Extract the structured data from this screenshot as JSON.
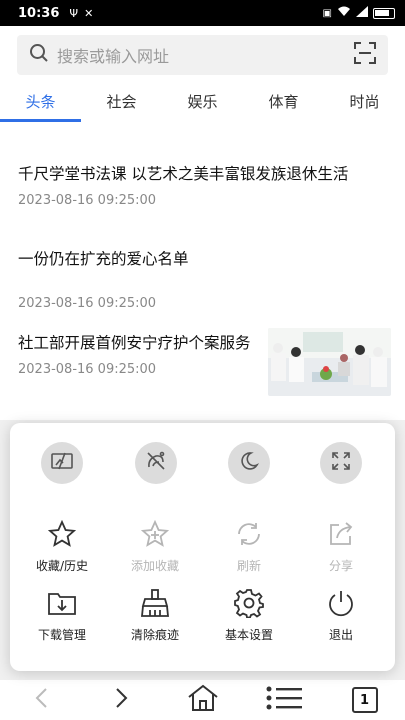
{
  "status_bar": {
    "time": "10:36",
    "battery": "100"
  },
  "search": {
    "placeholder": "搜索或输入网址"
  },
  "tabs": [
    {
      "label": "头条",
      "active": true
    },
    {
      "label": "社会"
    },
    {
      "label": "娱乐"
    },
    {
      "label": "体育"
    },
    {
      "label": "时尚"
    }
  ],
  "news": [
    {
      "title": "千尺学堂书法课 以艺术之美丰富银发族退休生活",
      "time": "2023-08-16 09:25:00"
    },
    {
      "title": "一份仍在扩充的爱心名单",
      "time": "2023-08-16 09:25:00"
    },
    {
      "title": "社工部开展首例安宁疗护个案服务",
      "time": "2023-08-16 09:25:00"
    }
  ],
  "menu": {
    "items": [
      {
        "label": "收藏/历史"
      },
      {
        "label": "添加收藏"
      },
      {
        "label": "刷新"
      },
      {
        "label": "分享"
      },
      {
        "label": "下载管理"
      },
      {
        "label": "清除痕迹"
      },
      {
        "label": "基本设置"
      },
      {
        "label": "退出"
      }
    ]
  },
  "bottom_nav": {
    "tab_count": "1"
  },
  "colors": {
    "accent": "#2f6fe6",
    "disabled": "#b5b5b5"
  }
}
